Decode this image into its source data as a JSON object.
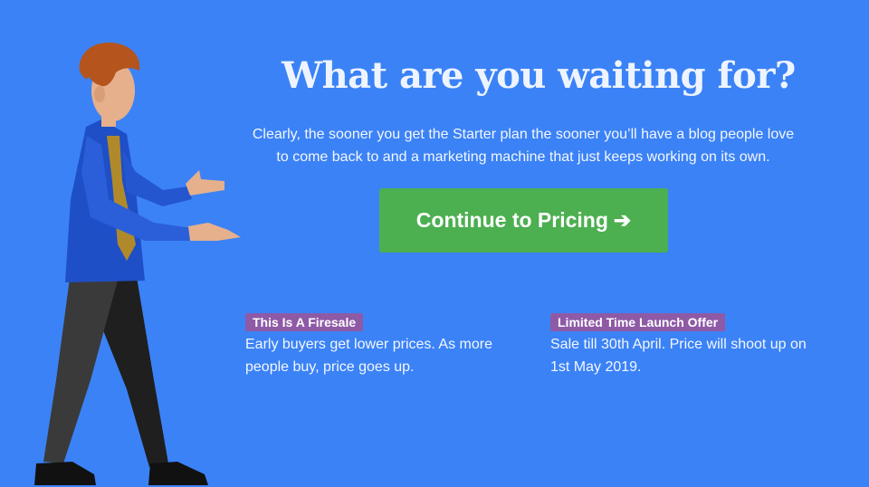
{
  "hero": {
    "title": "What are you waiting for?",
    "subtitle": "Clearly, the sooner you get the Starter plan the sooner you’ll have a blog people love to come back to and a marketing machine that just keeps working on its own."
  },
  "cta": {
    "label": "Continue to Pricing",
    "arrow": "➔",
    "color": "#4caf50"
  },
  "features": [
    {
      "badge": "This Is A Firesale",
      "text": "Early buyers get lower prices. As more people buy, price goes up."
    },
    {
      "badge": "Limited Time Launch Offer",
      "text": "Sale till 30th April. Price will shoot up on 1st May 2019."
    }
  ],
  "colors": {
    "background": "#3b82f6",
    "badge": "#8e5aa6"
  }
}
